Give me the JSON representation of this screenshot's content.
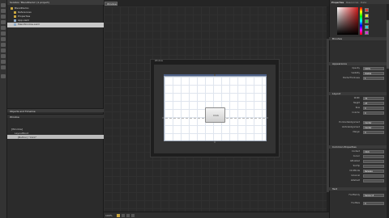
{
  "project_panel": {
    "title": "Solution 'BlendDemo' (1 project)",
    "items": [
      {
        "label": "BlendDemo"
      },
      {
        "label": "References"
      },
      {
        "label": "Properties"
      },
      {
        "label": "App.xaml"
      },
      {
        "label": "MainWindow.xaml"
      }
    ]
  },
  "objects_panel": {
    "header": "Objects and Timeline",
    "subheader": "Window",
    "rows": [
      {
        "label": "[Window]"
      },
      {
        "label": "LayoutRoot"
      },
      {
        "label": "[Button] \"Click\""
      }
    ]
  },
  "document_tab": {
    "label": "Window"
  },
  "artboard": {
    "label": "Window",
    "button_text": "Click"
  },
  "status_bar": {
    "zoom": "100%"
  },
  "properties_panel": {
    "tabs": [
      "Properties",
      "Resources",
      "Data"
    ],
    "name_field": "Button",
    "brushes_section": "Brushes",
    "appearance_section": "Appearance",
    "appearance_rows": [
      {
        "label": "Opacity",
        "value": "100%"
      },
      {
        "label": "Visibility",
        "value": "Visible"
      },
      {
        "label": "BorderThickness",
        "value": "1"
      }
    ],
    "layout_section": "Layout",
    "layout_rows": [
      {
        "label": "Width",
        "value": "75"
      },
      {
        "label": "Height",
        "value": "23"
      },
      {
        "label": "Row",
        "value": "0"
      },
      {
        "label": "Column",
        "value": "0"
      },
      {
        "label": "HorizontalAlignment",
        "value": "Center"
      },
      {
        "label": "VerticalAlignment",
        "value": "Center"
      },
      {
        "label": "Margin",
        "value": "0"
      }
    ],
    "common_section": "Common Properties",
    "common_rows": [
      {
        "label": "Content",
        "value": "Click"
      },
      {
        "label": "Cursor",
        "value": ""
      },
      {
        "label": "IsEnabled",
        "value": ""
      },
      {
        "label": "ToolTip",
        "value": ""
      },
      {
        "label": "ClickMode",
        "value": "Release"
      },
      {
        "label": "IsCancel",
        "value": ""
      },
      {
        "label": "IsDefault",
        "value": ""
      }
    ],
    "text_section": "Text",
    "text_rows": [
      {
        "label": "FontFamily",
        "value": "Segoe UI"
      },
      {
        "label": "FontSize",
        "value": "9"
      }
    ]
  },
  "colors": {
    "accent_stage_bar": "#4c5f86",
    "selection": "#c8c8c8"
  }
}
